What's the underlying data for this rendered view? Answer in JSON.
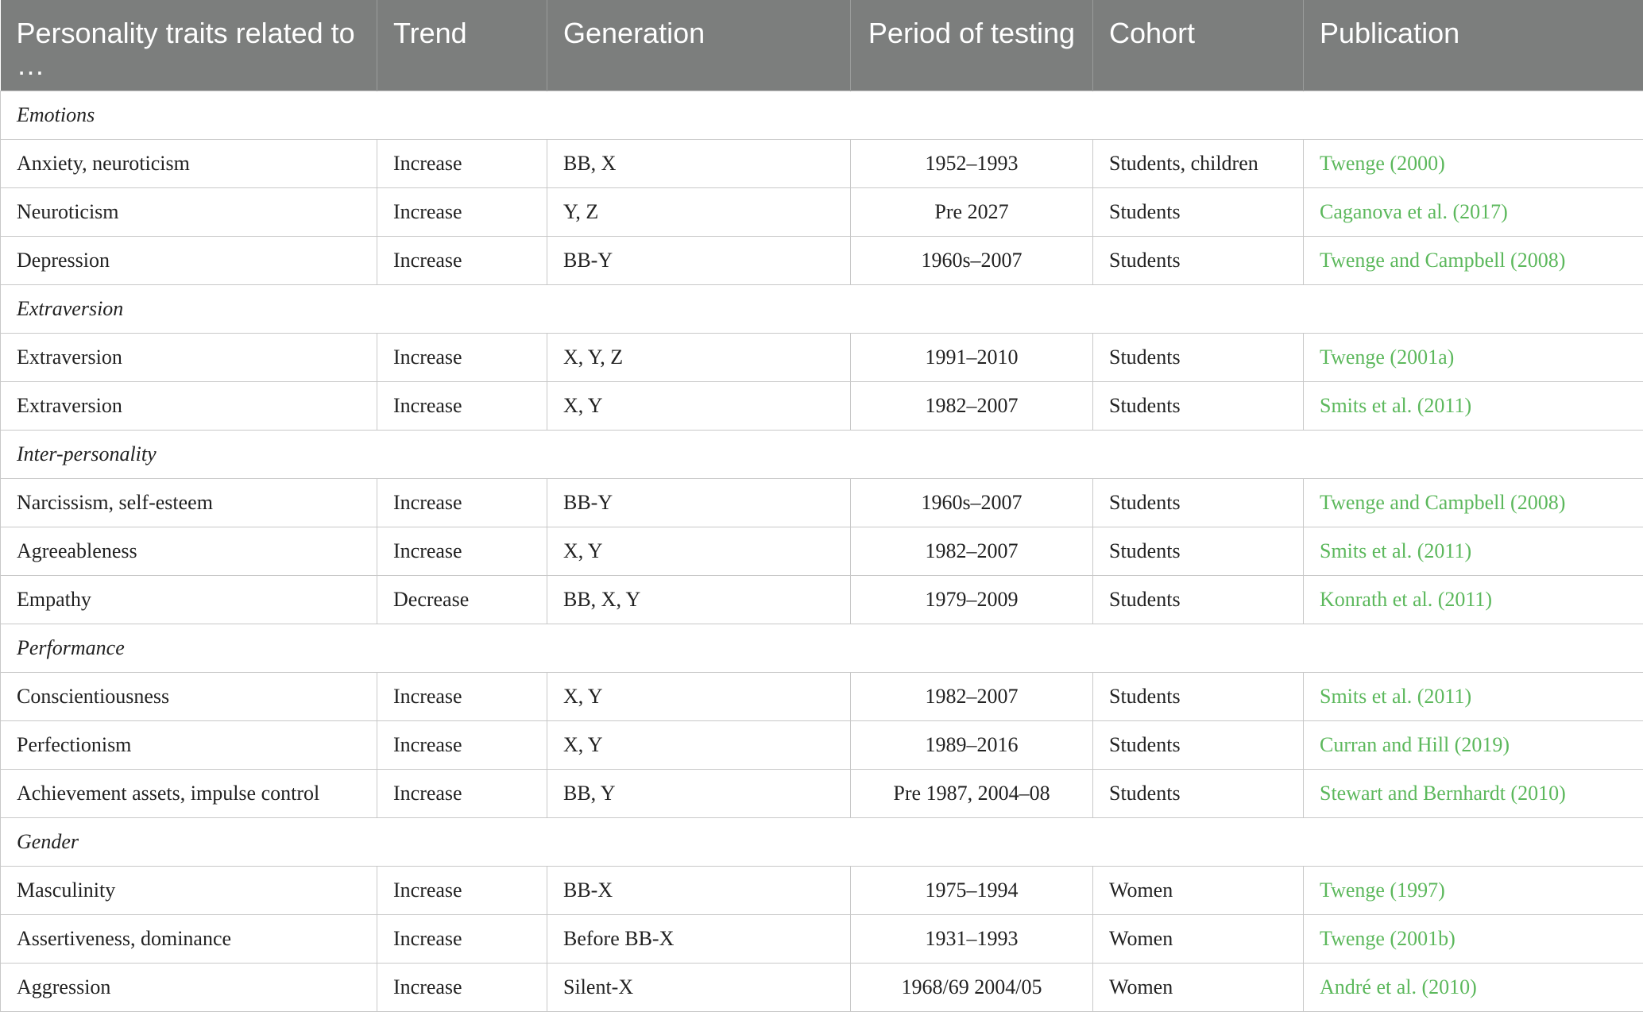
{
  "table": {
    "headers": [
      "Personality traits related to …",
      "Trend",
      "Generation",
      "Period of testing",
      "Cohort",
      "Publication"
    ],
    "sections": [
      {
        "group": "Emotions",
        "rows": [
          {
            "trait": "Anxiety, neuroticism",
            "trend": "Increase",
            "generation": "BB, X",
            "period": "1952–1993",
            "cohort": "Students, children",
            "publication": "Twenge (2000)"
          },
          {
            "trait": "Neuroticism",
            "trend": "Increase",
            "generation": "Y, Z",
            "period": "Pre 2027",
            "cohort": "Students",
            "publication": "Caganova et al. (2017)"
          },
          {
            "trait": "Depression",
            "trend": "Increase",
            "generation": "BB-Y",
            "period": "1960s–2007",
            "cohort": "Students",
            "publication": "Twenge and Campbell (2008)"
          }
        ]
      },
      {
        "group": "Extraversion",
        "rows": [
          {
            "trait": "Extraversion",
            "trend": "Increase",
            "generation": "X, Y, Z",
            "period": "1991–2010",
            "cohort": "Students",
            "publication": "Twenge (2001a)"
          },
          {
            "trait": "Extraversion",
            "trend": "Increase",
            "generation": "X, Y",
            "period": "1982–2007",
            "cohort": "Students",
            "publication": "Smits et al. (2011)"
          }
        ]
      },
      {
        "group": "Inter-personality",
        "rows": [
          {
            "trait": "Narcissism, self-esteem",
            "trend": "Increase",
            "generation": "BB-Y",
            "period": "1960s–2007",
            "cohort": "Students",
            "publication": "Twenge and Campbell (2008)"
          },
          {
            "trait": "Agreeableness",
            "trend": "Increase",
            "generation": "X, Y",
            "period": "1982–2007",
            "cohort": "Students",
            "publication": "Smits et al. (2011)"
          },
          {
            "trait": "Empathy",
            "trend": "Decrease",
            "generation": "BB, X, Y",
            "period": "1979–2009",
            "cohort": "Students",
            "publication": "Konrath et al. (2011)"
          }
        ]
      },
      {
        "group": "Performance",
        "rows": [
          {
            "trait": "Conscientiousness",
            "trend": "Increase",
            "generation": "X, Y",
            "period": "1982–2007",
            "cohort": "Students",
            "publication": "Smits et al. (2011)"
          },
          {
            "trait": "Perfectionism",
            "trend": "Increase",
            "generation": "X, Y",
            "period": "1989–2016",
            "cohort": "Students",
            "publication": "Curran and Hill (2019)"
          },
          {
            "trait": "Achievement assets, impulse control",
            "trend": "Increase",
            "generation": "BB, Y",
            "period": "Pre 1987, 2004–08",
            "cohort": "Students",
            "publication": "Stewart and Bernhardt (2010)"
          }
        ]
      },
      {
        "group": "Gender",
        "rows": [
          {
            "trait": "Masculinity",
            "trend": "Increase",
            "generation": "BB-X",
            "period": "1975–1994",
            "cohort": "Women",
            "publication": "Twenge (1997)"
          },
          {
            "trait": "Assertiveness, dominance",
            "trend": "Increase",
            "generation": "Before BB-X",
            "period": "1931–1993",
            "cohort": "Women",
            "publication": "Twenge (2001b)"
          },
          {
            "trait": "Aggression",
            "trend": "Increase",
            "generation": "Silent-X",
            "period": "1968/69 2004/05",
            "cohort": "Women",
            "publication": "André et al. (2010)"
          }
        ]
      }
    ]
  },
  "colors": {
    "header_bg": "#7c7e7d",
    "header_text": "#ffffff",
    "link": "#5cb85c",
    "border": "#c8c8c8"
  }
}
